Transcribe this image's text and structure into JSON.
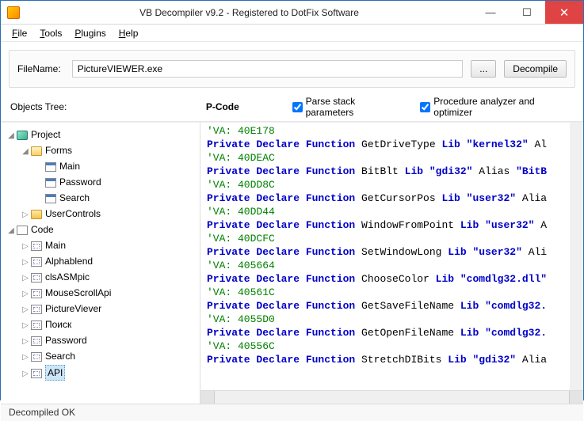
{
  "window": {
    "title": "VB Decompiler v9.2 - Registered to DotFix Software"
  },
  "menu": {
    "file": "File",
    "tools": "Tools",
    "plugins": "Plugins",
    "help": "Help"
  },
  "toolbar": {
    "filename_label": "FileName:",
    "filename_value": "PictureVIEWER.exe",
    "browse": "...",
    "decompile": "Decompile"
  },
  "row2": {
    "objects": "Objects Tree:",
    "pcode": "P-Code",
    "parse_label": "Parse stack parameters",
    "proc_label": "Procedure analyzer and optimizer"
  },
  "tree": {
    "project": "Project",
    "forms": "Forms",
    "forms_items": [
      "Main",
      "Password",
      "Search"
    ],
    "usercontrols": "UserControls",
    "code": "Code",
    "code_items": [
      "Main",
      "Alphablend",
      "clsASMpic",
      "MouseScrollApi",
      "PictureViever",
      "Поиск",
      "Password",
      "Search",
      "API"
    ]
  },
  "code_lines": [
    {
      "t": "cmt",
      "v": "'VA: 40E178"
    },
    {
      "t": "decl",
      "kw1": "Private Declare Function",
      "name": "GetDriveType",
      "kw2": "Lib",
      "str": "\"kernel32\"",
      "tail": " Al"
    },
    {
      "t": "cmt",
      "v": "'VA: 40DEAC"
    },
    {
      "t": "decl",
      "kw1": "Private Declare Function",
      "name": "BitBlt",
      "kw2": "Lib",
      "str": "\"gdi32\"",
      "tail": " Alias ",
      "str2": "\"BitB"
    },
    {
      "t": "cmt",
      "v": "'VA: 40DD8C"
    },
    {
      "t": "decl",
      "kw1": "Private Declare Function",
      "name": "GetCursorPos",
      "kw2": "Lib",
      "str": "\"user32\"",
      "tail": " Alia"
    },
    {
      "t": "cmt",
      "v": "'VA: 40DD44"
    },
    {
      "t": "decl",
      "kw1": "Private Declare Function",
      "name": "WindowFromPoint",
      "kw2": "Lib",
      "str": "\"user32\"",
      "tail": " A"
    },
    {
      "t": "cmt",
      "v": "'VA: 40DCFC"
    },
    {
      "t": "decl",
      "kw1": "Private Declare Function",
      "name": "SetWindowLong",
      "kw2": "Lib",
      "str": "\"user32\"",
      "tail": " Ali"
    },
    {
      "t": "cmt",
      "v": "'VA: 405664"
    },
    {
      "t": "decl",
      "kw1": "Private Declare Function",
      "name": "ChooseColor",
      "kw2": "Lib",
      "str": "\"comdlg32.dll\"",
      "tail": ""
    },
    {
      "t": "cmt",
      "v": "'VA: 40561C"
    },
    {
      "t": "decl",
      "kw1": "Private Declare Function",
      "name": "GetSaveFileName",
      "kw2": "Lib",
      "str": "\"comdlg32.",
      "tail": ""
    },
    {
      "t": "cmt",
      "v": "'VA: 4055D0"
    },
    {
      "t": "decl",
      "kw1": "Private Declare Function",
      "name": "GetOpenFileName",
      "kw2": "Lib",
      "str": "\"comdlg32.",
      "tail": ""
    },
    {
      "t": "cmt",
      "v": "'VA: 40556C"
    },
    {
      "t": "decl",
      "kw1": "Private Declare Function",
      "name": "StretchDIBits",
      "kw2": "Lib",
      "str": "\"gdi32\"",
      "tail": " Alia"
    }
  ],
  "status": "Decompiled OK"
}
